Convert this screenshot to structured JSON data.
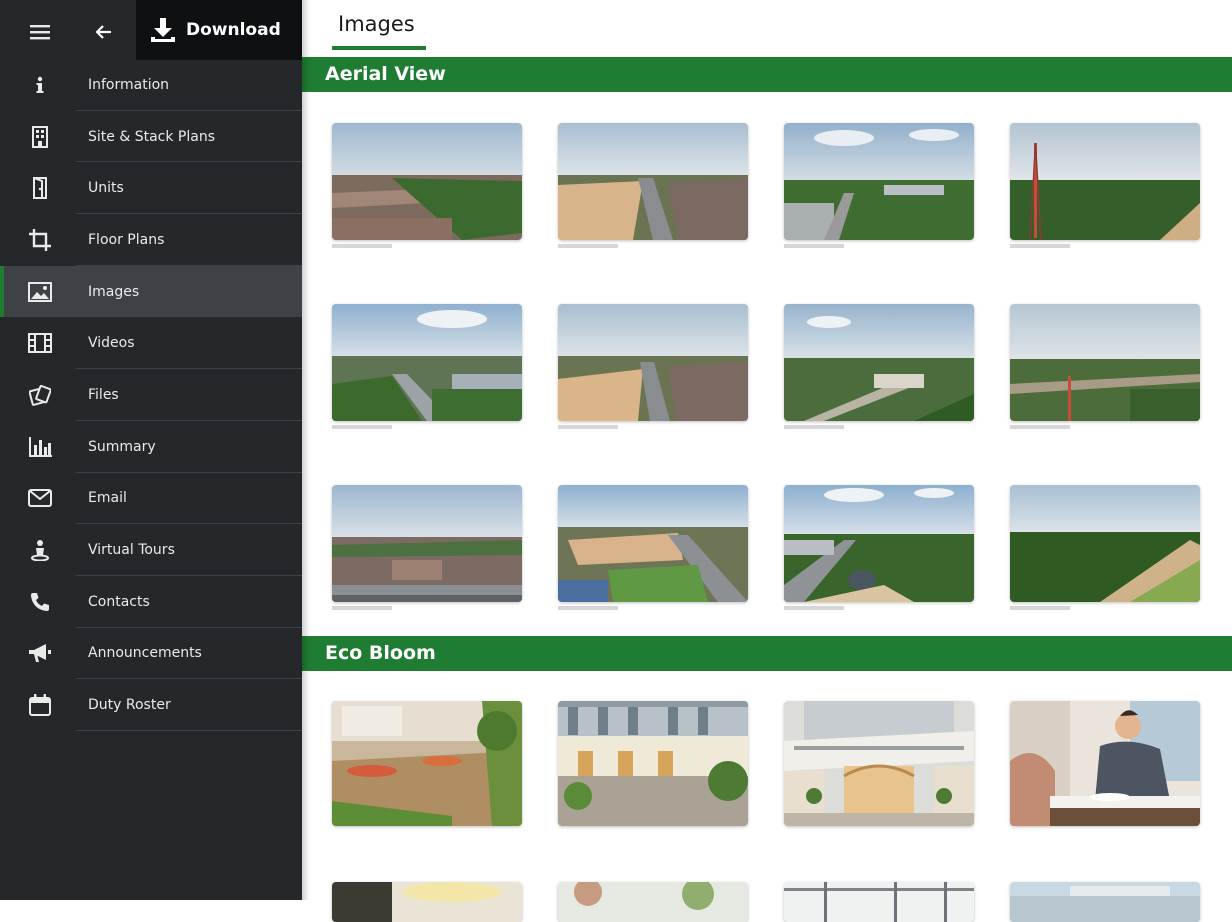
{
  "sidebar": {
    "download_label": "Download",
    "items": [
      {
        "label": "Information",
        "icon": "info-icon"
      },
      {
        "label": "Site & Stack Plans",
        "icon": "building-icon"
      },
      {
        "label": "Units",
        "icon": "door-icon"
      },
      {
        "label": "Floor Plans",
        "icon": "crop-icon"
      },
      {
        "label": "Images",
        "icon": "image-icon",
        "active": true
      },
      {
        "label": "Videos",
        "icon": "film-icon"
      },
      {
        "label": "Files",
        "icon": "files-icon"
      },
      {
        "label": "Summary",
        "icon": "bar-chart-icon"
      },
      {
        "label": "Email",
        "icon": "mail-icon"
      },
      {
        "label": "Virtual Tours",
        "icon": "person-pin-icon"
      },
      {
        "label": "Contacts",
        "icon": "phone-icon"
      },
      {
        "label": "Announcements",
        "icon": "megaphone-icon"
      },
      {
        "label": "Duty Roster",
        "icon": "calendar-icon"
      }
    ]
  },
  "main": {
    "tab_label": "Images",
    "sections": [
      {
        "title": "Aerial View"
      },
      {
        "title": "Eco Bloom"
      }
    ]
  },
  "colors": {
    "accent_green": "#1e7d32",
    "sidebar_bg": "#25282b",
    "sidebar_active": "#3e4247"
  }
}
